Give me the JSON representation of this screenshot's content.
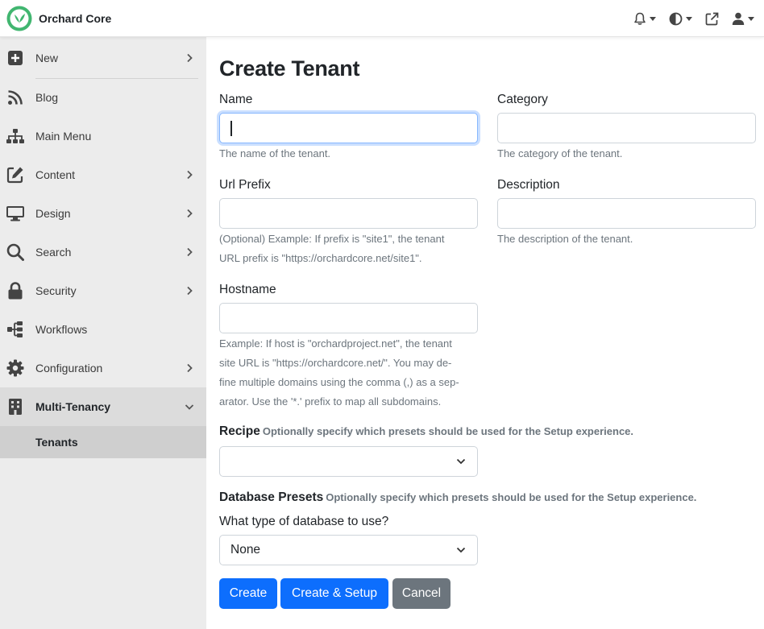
{
  "app": {
    "title": "Orchard Core"
  },
  "topbar": {
    "icons": [
      "bell-icon",
      "contrast-icon",
      "external-link-icon",
      "user-icon"
    ]
  },
  "sidebar": {
    "items": [
      {
        "label": "New",
        "icon": "plus-square-icon",
        "chevron": "right"
      },
      {
        "label": "Blog",
        "icon": "rss-icon",
        "chevron": ""
      },
      {
        "label": "Main Menu",
        "icon": "sitemap-icon",
        "chevron": ""
      },
      {
        "label": "Content",
        "icon": "edit-icon",
        "chevron": "right"
      },
      {
        "label": "Design",
        "icon": "desktop-icon",
        "chevron": "right"
      },
      {
        "label": "Search",
        "icon": "search-icon",
        "chevron": "right"
      },
      {
        "label": "Security",
        "icon": "lock-icon",
        "chevron": "right"
      },
      {
        "label": "Workflows",
        "icon": "workflow-icon",
        "chevron": ""
      },
      {
        "label": "Configuration",
        "icon": "gear-icon",
        "chevron": "right"
      },
      {
        "label": "Multi-Tenancy",
        "icon": "building-icon",
        "chevron": "down"
      }
    ],
    "sub_item": "Tenants"
  },
  "form": {
    "title": "Create Tenant",
    "name": {
      "label": "Name",
      "value": "",
      "hint": "The name of the tenant."
    },
    "category": {
      "label": "Category",
      "value": "",
      "hint": "The category of the tenant."
    },
    "url_prefix": {
      "label": "Url Prefix",
      "value": "",
      "hint_line1": "(Optional) Example: If prefix is \"site1\", the tenant",
      "hint_line2": "URL prefix is \"https://orchardcore.net/site1\"."
    },
    "description": {
      "label": "Description",
      "value": "",
      "hint": "The description of the tenant."
    },
    "hostname": {
      "label": "Hostname",
      "value": "",
      "hint_line1": "Example: If host is \"orchardproject.net\", the tenant",
      "hint_line2": "site URL is \"https://orchardcore.net/\". You may de-",
      "hint_line3": "fine multiple domains using the comma (,) as a sep-",
      "hint_line4": "arator. Use the '*.' prefix to map all subdomains."
    },
    "recipe": {
      "label": "Recipe",
      "sub": "Optionally specify which presets should be used for the Setup experience.",
      "value": ""
    },
    "database_presets": {
      "label": "Database Presets",
      "sub": "Optionally specify which presets should be used for the Setup experience.",
      "question": "What type of database to use?",
      "value": "None"
    },
    "buttons": {
      "create": "Create",
      "create_setup": "Create & Setup",
      "cancel": "Cancel"
    }
  },
  "colors": {
    "primary": "#0d6efd",
    "secondary": "#6c757d",
    "brand_green": "#41b670",
    "sidebar_bg": "#ececec"
  }
}
